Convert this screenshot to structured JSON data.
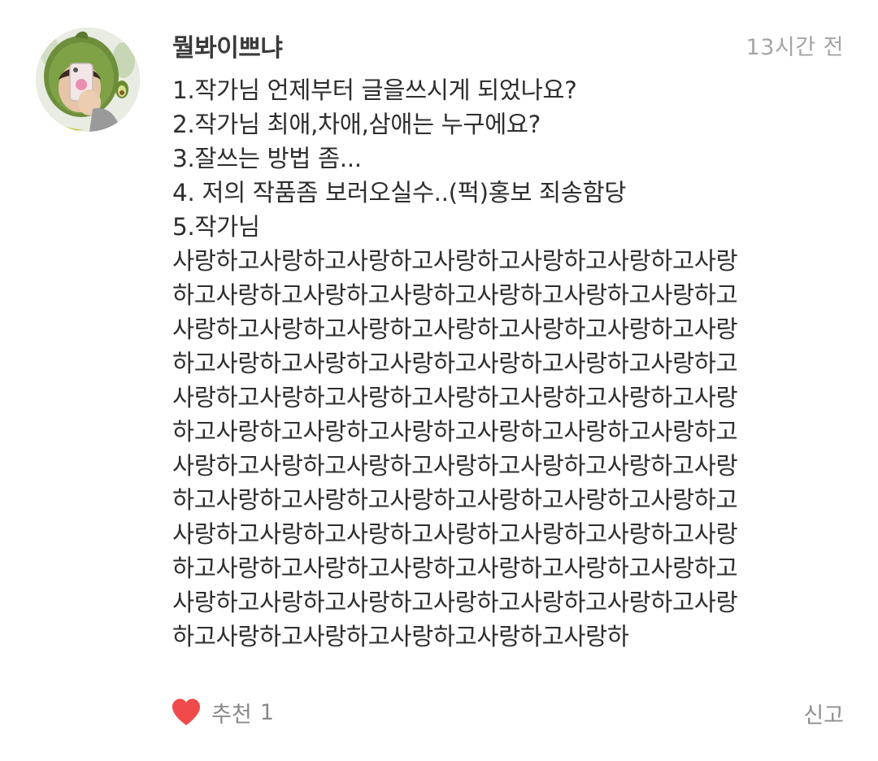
{
  "comment": {
    "author": "뭘봐이쁘냐",
    "time": "13시간 전",
    "avatar_icon": "user-avatar-photo",
    "lines": [
      "1.작가님 언제부터 글을쓰시게 되었나요?",
      "2.작가님 최애,차애,삼애는 누구에요?",
      "3.잘쓰는 방법 좀...",
      "4. 저의 작품좀 보러오실수..(퍽)홍보 죄송함당",
      "5.작가님",
      "사랑하고사랑하고사랑하고사랑하고사랑하고사랑하고사랑",
      "하고사랑하고사랑하고사랑하고사랑하고사랑하고사랑하고",
      "사랑하고사랑하고사랑하고사랑하고사랑하고사랑하고사랑",
      "하고사랑하고사랑하고사랑하고사랑하고사랑하고사랑하고",
      "사랑하고사랑하고사랑하고사랑하고사랑하고사랑하고사랑",
      "하고사랑하고사랑하고사랑하고사랑하고사랑하고사랑하고",
      "사랑하고사랑하고사랑하고사랑하고사랑하고사랑하고사랑",
      "하고사랑하고사랑하고사랑하고사랑하고사랑하고사랑하고",
      "사랑하고사랑하고사랑하고사랑하고사랑하고사랑하고사랑",
      "하고사랑하고사랑하고사랑하고사랑하고사랑하고사랑하고",
      "사랑하고사랑하고사랑하고사랑하고사랑하고사랑하고사랑",
      "하고사랑하고사랑하고사랑하고사랑하고사랑하"
    ]
  },
  "footer": {
    "like_icon": "heart-icon",
    "like_label": "추천",
    "like_count": "1",
    "report_label": "신고"
  },
  "colors": {
    "heart": "#f04a4a",
    "muted_text": "#a5a5a5",
    "body_text": "#2e2e2e"
  }
}
